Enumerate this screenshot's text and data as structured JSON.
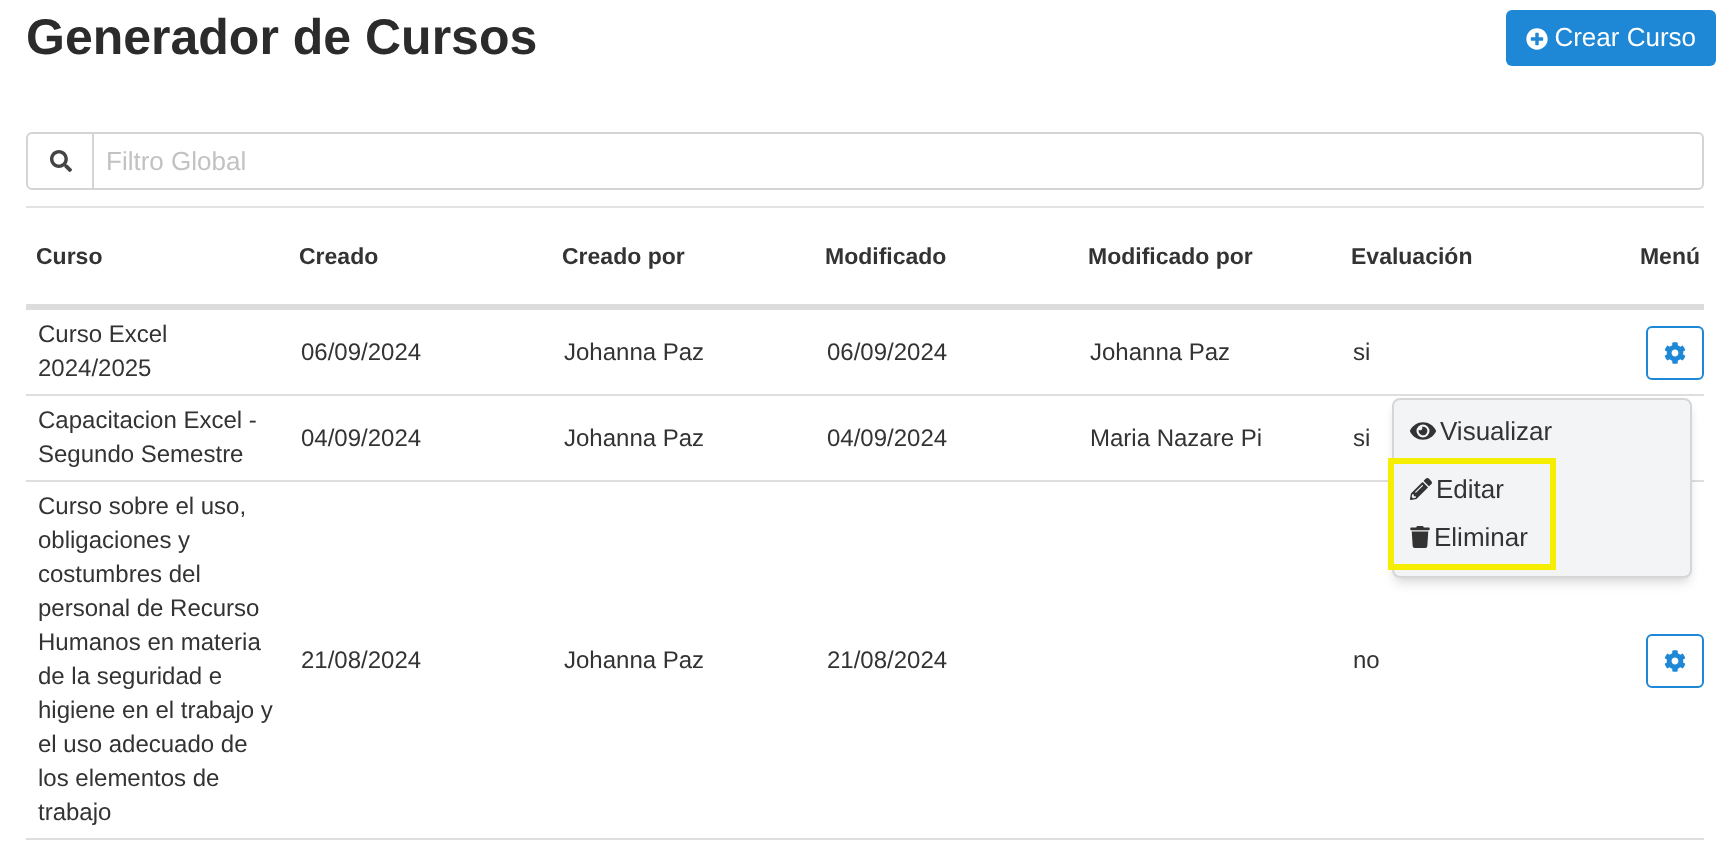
{
  "title": "Generador de Cursos",
  "create_button": {
    "label": "Crear Curso"
  },
  "search": {
    "placeholder": "Filtro Global"
  },
  "table": {
    "columns": [
      "Curso",
      "Creado",
      "Creado por",
      "Modificado",
      "Modificado por",
      "Evaluación",
      "Menú"
    ],
    "rows": [
      {
        "cells": [
          "Curso Excel 2024/2025",
          "06/09/2024",
          "Johanna Paz",
          "06/09/2024",
          "Johanna Paz",
          "si"
        ],
        "dropdown": {
          "items": [
            {
              "kind": "view",
              "label": "Visualizar",
              "highlighted": false
            },
            {
              "kind": "edit",
              "label": "Editar",
              "highlighted": true
            },
            {
              "kind": "delete",
              "label": "Eliminar",
              "highlighted": true
            }
          ]
        }
      },
      {
        "cells": [
          "Capacitacion Excel - Segundo Semestre",
          "04/09/2024",
          "Johanna Paz",
          "04/09/2024",
          "Maria Nazare Pi",
          "si"
        ]
      },
      {
        "cells": [
          "Curso sobre el uso, obligaciones y costumbres del personal de Recurso Humanos en materia de la seguridad e higiene en el trabajo y el uso adecuado de los elementos de trabajo",
          "21/08/2024",
          "Johanna Paz",
          "21/08/2024",
          "",
          "no"
        ]
      }
    ]
  }
}
